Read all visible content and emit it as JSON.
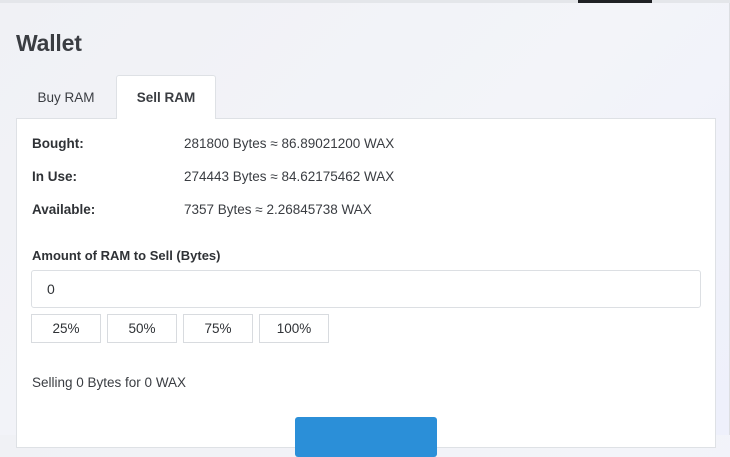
{
  "page": {
    "title": "Wallet"
  },
  "tabs": [
    {
      "label": "Buy RAM",
      "active": false
    },
    {
      "label": "Sell RAM",
      "active": true
    }
  ],
  "ram_info": {
    "bought": {
      "label": "Bought:",
      "value": "281800 Bytes ≈ 86.89021200 WAX"
    },
    "in_use": {
      "label": "In Use:",
      "value": "274443 Bytes ≈ 84.62175462 WAX"
    },
    "available": {
      "label": "Available:",
      "value": "7357 Bytes ≈ 2.26845738 WAX"
    }
  },
  "sell_form": {
    "amount_label": "Amount of RAM to Sell (Bytes)",
    "amount_value": "0",
    "percent_buttons": [
      "25%",
      "50%",
      "75%",
      "100%"
    ],
    "summary": "Selling 0 Bytes for 0 WAX"
  },
  "colors": {
    "accent": "#2b8fd8",
    "panel_border": "#dee1e5",
    "background": "#f1f2f7"
  }
}
